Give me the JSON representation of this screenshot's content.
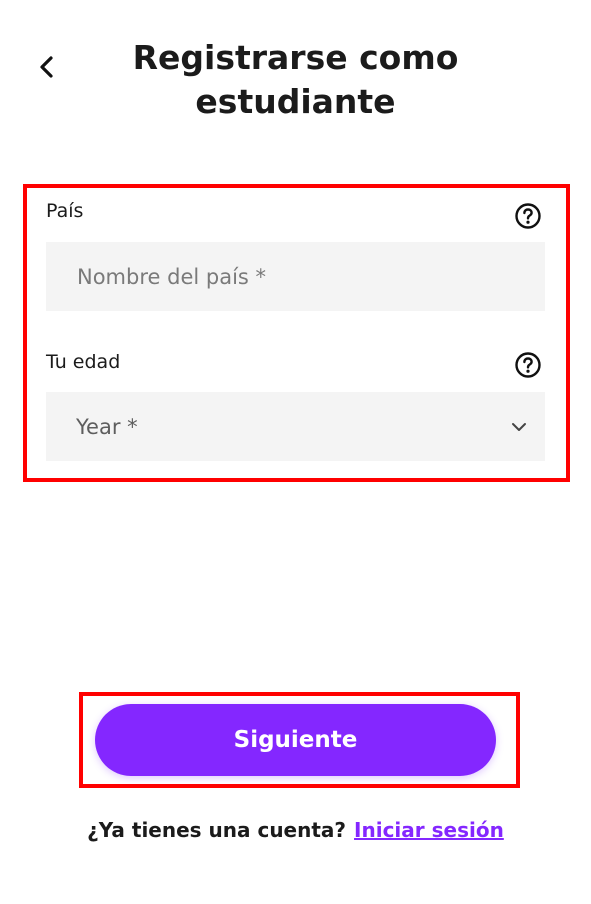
{
  "header": {
    "title": "Registrarse como estudiante",
    "back_icon": "chevron-left-icon"
  },
  "form": {
    "country": {
      "label": "País",
      "placeholder": "Nombre del país *",
      "value": "",
      "help_icon": "question-circle-icon"
    },
    "age": {
      "label": "Tu edad",
      "selected_value": "Year *",
      "help_icon": "question-circle-icon",
      "dropdown_icon": "chevron-down-icon"
    }
  },
  "actions": {
    "next_label": "Siguiente"
  },
  "footer": {
    "account_prompt": "¿Ya tienes una cuenta?",
    "login_label": "Iniciar sesión"
  },
  "colors": {
    "accent": "#8427ff",
    "field_background": "#f4f4f4",
    "highlight": "#ff0000"
  }
}
